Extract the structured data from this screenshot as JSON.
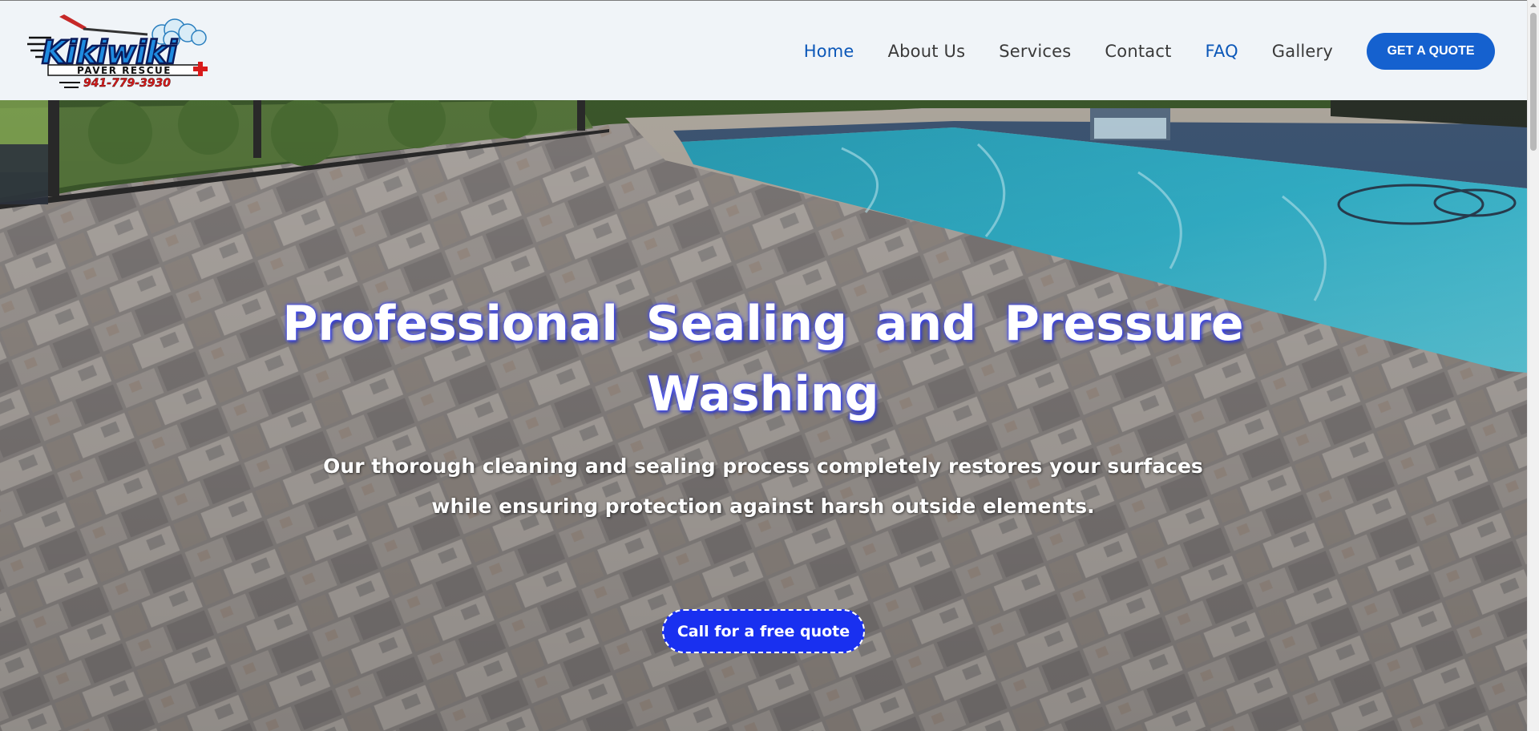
{
  "logo": {
    "brand_text": "Kikiwiki",
    "tagline": "PAVER RESCUE",
    "phone": "941-779-3930"
  },
  "nav": {
    "items": [
      {
        "label": "Home"
      },
      {
        "label": "About Us"
      },
      {
        "label": "Services"
      },
      {
        "label": "Contact"
      },
      {
        "label": "FAQ"
      },
      {
        "label": "Gallery"
      }
    ],
    "cta_label": "GET A QUOTE"
  },
  "hero": {
    "title_line1": "Professional Sealing and Pressure",
    "title_line2": "Washing",
    "subtitle_line1": "Our thorough cleaning and sealing process completely restores your surfaces",
    "subtitle_line2": "while ensuring protection against harsh outside elements.",
    "cta_label": "Call for a free quote"
  },
  "colors": {
    "accent": "#1561cf",
    "nav_active": "#0b57b8",
    "hero_cta": "#1930f0",
    "title_glow": "#4c54ff"
  }
}
